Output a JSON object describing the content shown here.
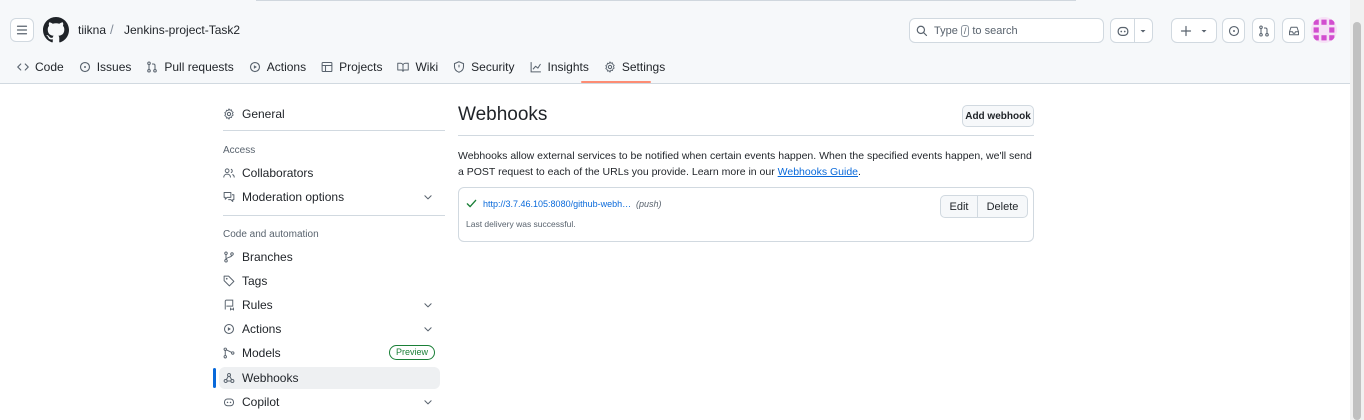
{
  "header": {
    "owner": "tiikna",
    "separator": "/",
    "repo": "Jenkins-project-Task2",
    "search": {
      "prefix": "Type",
      "key": "/",
      "suffix": "to search"
    }
  },
  "tabs": [
    {
      "label": "Code",
      "icon": "code-icon"
    },
    {
      "label": "Issues",
      "icon": "issue-icon"
    },
    {
      "label": "Pull requests",
      "icon": "pull-request-icon"
    },
    {
      "label": "Actions",
      "icon": "play-icon"
    },
    {
      "label": "Projects",
      "icon": "table-icon"
    },
    {
      "label": "Wiki",
      "icon": "book-icon"
    },
    {
      "label": "Security",
      "icon": "shield-icon"
    },
    {
      "label": "Insights",
      "icon": "graph-icon"
    },
    {
      "label": "Settings",
      "icon": "gear-icon",
      "selected": true
    }
  ],
  "sidebar": {
    "general": "General",
    "access_heading": "Access",
    "collaborators": "Collaborators",
    "moderation": "Moderation options",
    "code_heading": "Code and automation",
    "branches": "Branches",
    "tags": "Tags",
    "rules": "Rules",
    "actions": "Actions",
    "models": "Models",
    "models_badge": "Preview",
    "webhooks": "Webhooks",
    "copilot": "Copilot"
  },
  "main": {
    "title": "Webhooks",
    "add_button": "Add webhook",
    "description": "Webhooks allow external services to be notified when certain events happen. When the specified events happen, we'll send a POST request to each of the URLs you provide. Learn more in our",
    "guide_link": "Webhooks Guide",
    "after_link": ".",
    "hook": {
      "url": "http://3.7.46.105:8080/github-webh…",
      "event": "(push)",
      "status": "Last delivery was successful.",
      "edit": "Edit",
      "delete": "Delete"
    }
  },
  "colors": {
    "accent": "#0969da",
    "selected_tab_underline": "#fd8c73",
    "success": "#1a7f37"
  }
}
